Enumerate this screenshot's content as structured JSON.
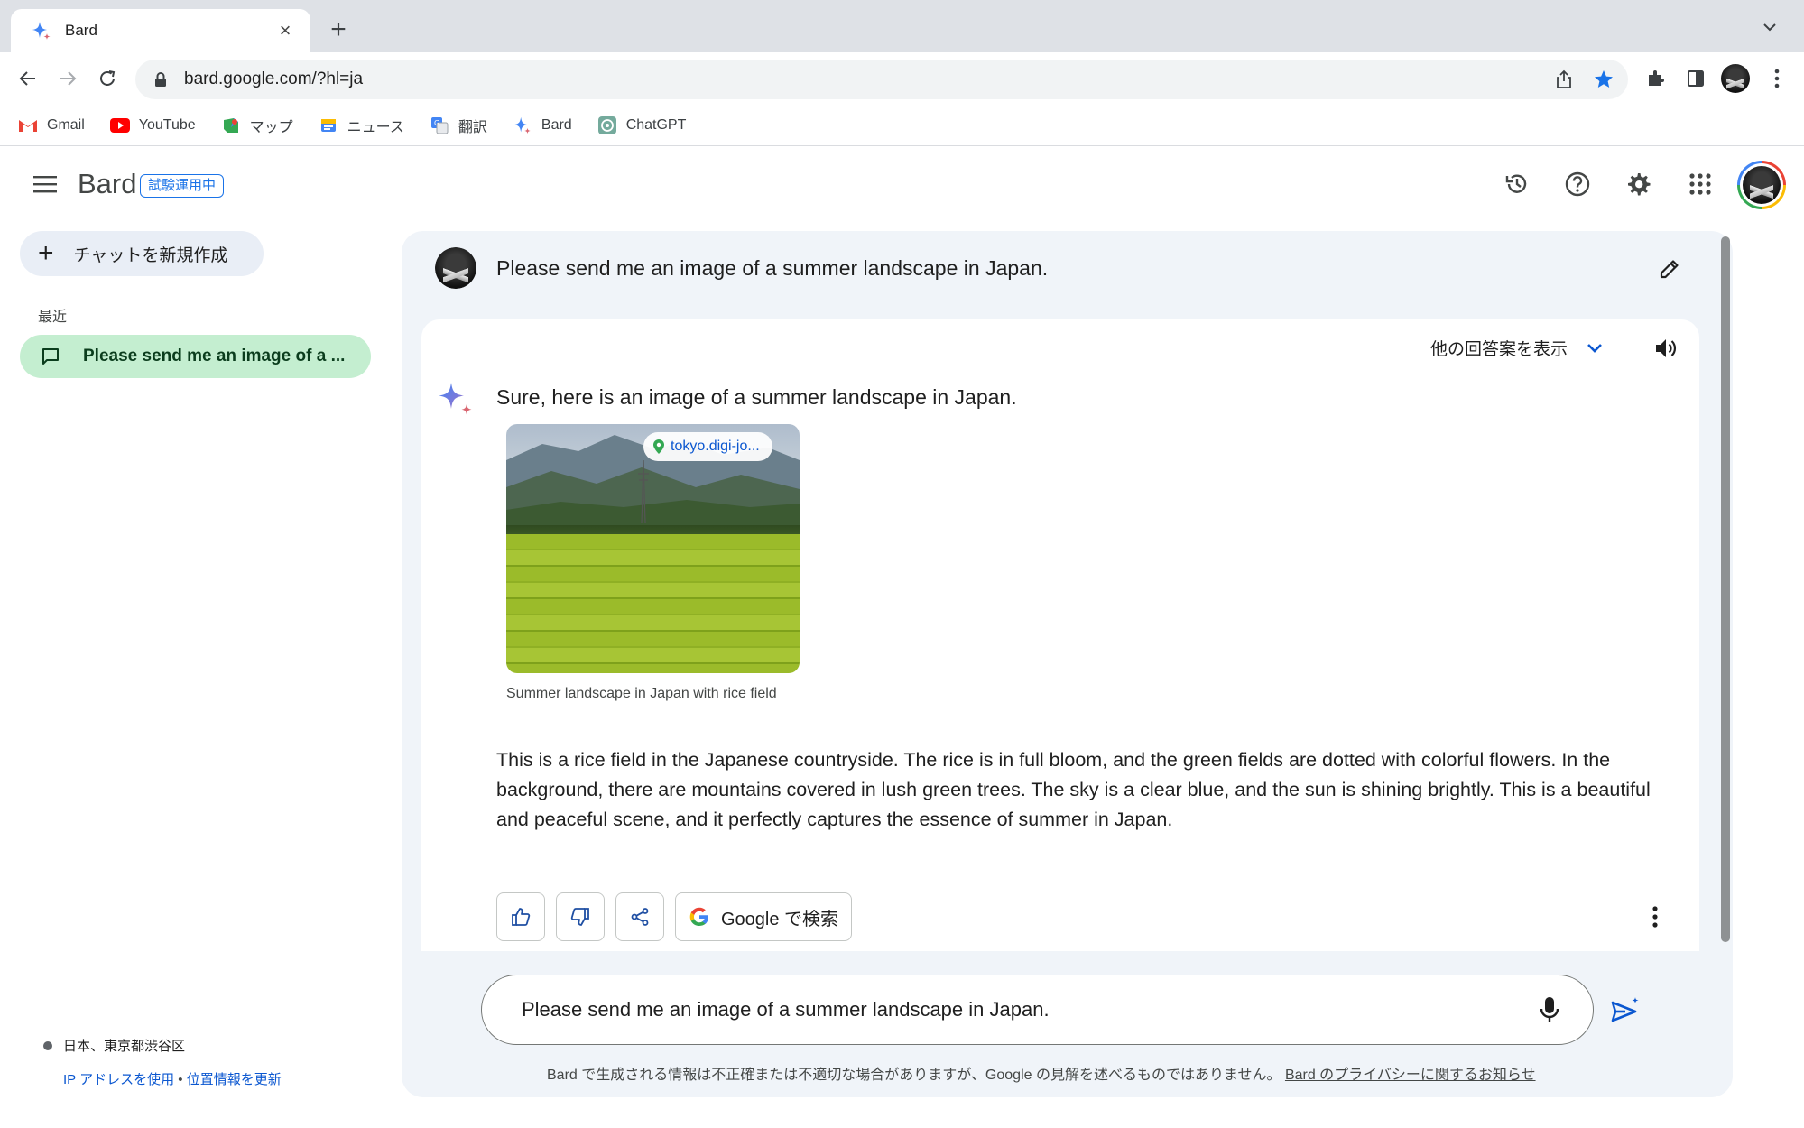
{
  "browser": {
    "tab_title": "Bard",
    "url": "bard.google.com/?hl=ja",
    "bookmarks": [
      {
        "label": "Gmail",
        "icon": "gmail-icon"
      },
      {
        "label": "YouTube",
        "icon": "youtube-icon"
      },
      {
        "label": "マップ",
        "icon": "maps-icon"
      },
      {
        "label": "ニュース",
        "icon": "news-icon"
      },
      {
        "label": "翻訳",
        "icon": "translate-icon"
      },
      {
        "label": "Bard",
        "icon": "bard-icon"
      },
      {
        "label": "ChatGPT",
        "icon": "chatgpt-icon"
      }
    ]
  },
  "header": {
    "brand": "Bard",
    "badge": "試験運用中"
  },
  "sidebar": {
    "new_chat": "チャットを新規作成",
    "recent_label": "最近",
    "recent_items": [
      {
        "label": "Please send me an image of a ..."
      }
    ],
    "location": "日本、東京都渋谷区",
    "ip_link": "IP アドレスを使用",
    "separator": "•",
    "update_link": "位置情報を更新"
  },
  "conversation": {
    "question": "Please send me an image of a summer landscape in Japan.",
    "drafts_label": "他の回答案を表示",
    "answer_intro": "Sure, here is an image of a summer landscape in Japan.",
    "image_source": "tokyo.digi-jo...",
    "image_caption": "Summer landscape in Japan with rice field",
    "answer_body": "This is a rice field in the Japanese countryside. The rice is in full bloom, and the green fields are dotted with colorful flowers. In the background, there are mountains covered in lush green trees. The sky is a clear blue, and the sun is shining brightly. This is a beautiful and peaceful scene, and it perfectly captures the essence of summer in Japan.",
    "google_search_label": "Google で検索"
  },
  "input": {
    "value": "Please send me an image of a summer landscape in Japan."
  },
  "footer": {
    "disclaimer": "Bard で生成される情報は不正確または不適切な場合がありますが、Google の見解を述べるものではありません。",
    "privacy_link": "Bard のプライバシーに関するお知らせ"
  },
  "colors": {
    "accent": "#1a73e8",
    "recent_item_bg": "#c4eed0",
    "panel_bg": "#f0f4f9"
  }
}
